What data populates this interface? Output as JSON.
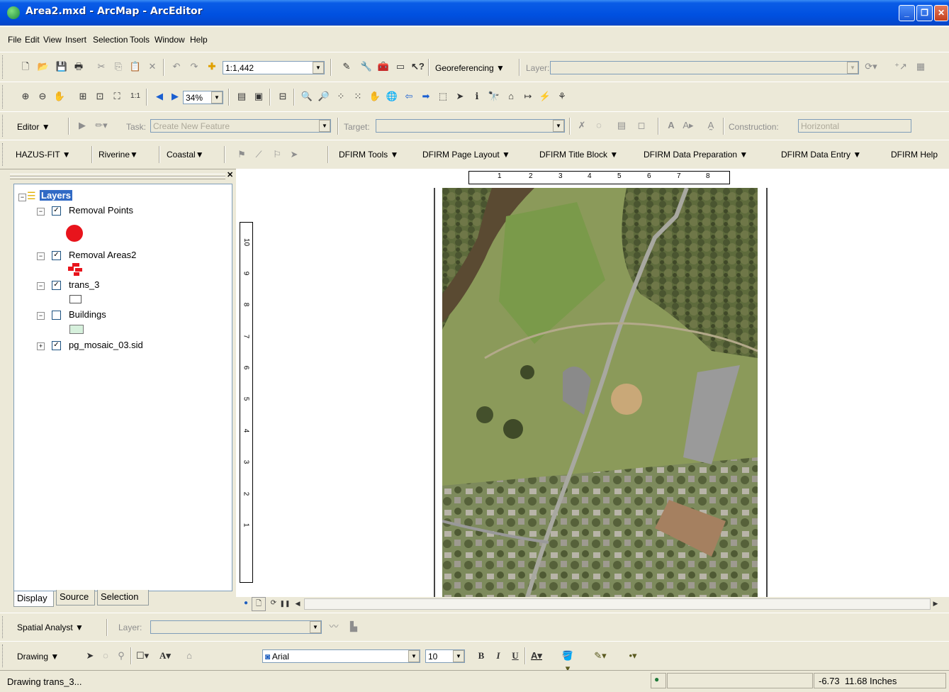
{
  "window": {
    "title": "Area2.mxd - ArcMap - ArcEditor"
  },
  "menu": [
    "File",
    "Edit",
    "View",
    "Insert",
    "Selection",
    "Tools",
    "Window",
    "Help"
  ],
  "standard_toolbar": {
    "scale": "1:1,442",
    "georeferencing": "Georeferencing",
    "layer_label": "Layer:"
  },
  "layout_toolbar": {
    "zoom": "34%"
  },
  "editor_toolbar": {
    "editor": "Editor",
    "task_label": "Task:",
    "task_value": "Create New Feature",
    "target_label": "Target:",
    "construction_label": "Construction:",
    "construction_value": "Horizontal"
  },
  "dfirm_toolbar": {
    "hazus": "HAZUS-FIT",
    "riverine": "Riverine",
    "coastal": "Coastal",
    "items": [
      "DFIRM Tools",
      "DFIRM Page Layout",
      "DFIRM Title Block",
      "DFIRM Data Preparation",
      "DFIRM Data Entry",
      "DFIRM Help"
    ]
  },
  "toc": {
    "root": "Layers",
    "layers": [
      {
        "name": "Removal Points",
        "checked": true
      },
      {
        "name": "Removal Areas2",
        "checked": true
      },
      {
        "name": "trans_3",
        "checked": true
      },
      {
        "name": "Buildings",
        "checked": false
      },
      {
        "name": "pg_mosaic_03.sid",
        "checked": true
      }
    ],
    "tabs": [
      "Display",
      "Source",
      "Selection"
    ]
  },
  "rulers": {
    "horizontal": [
      "1",
      "2",
      "3",
      "4",
      "5",
      "6",
      "7",
      "8"
    ],
    "vertical": [
      "10",
      "9",
      "8",
      "7",
      "6",
      "5",
      "4",
      "3",
      "2",
      "1"
    ]
  },
  "spatial_analyst": {
    "label": "Spatial Analyst",
    "layer_label": "Layer:"
  },
  "drawing_toolbar": {
    "label": "Drawing",
    "font": "Arial",
    "size": "10",
    "bold": "B",
    "italic": "I",
    "underline": "U"
  },
  "status": {
    "message": "Drawing trans_3...",
    "coords": "-6.73  11.68 Inches"
  },
  "colors": {
    "title_bar": "#0050e0",
    "removal_point": "#e8141c",
    "buildings_fill": "#d6f0dc"
  }
}
